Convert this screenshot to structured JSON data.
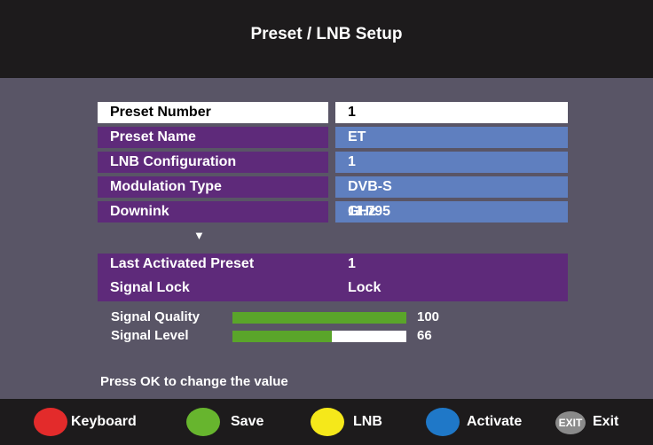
{
  "header": {
    "title": "Preset / LNB Setup"
  },
  "settings": {
    "preset_number": {
      "label": "Preset Number",
      "value": "1"
    },
    "preset_name": {
      "label": "Preset Name",
      "value": "ET"
    },
    "lnb_configuration": {
      "label": "LNB Configuration",
      "value": "1"
    },
    "modulation_type": {
      "label": "Modulation Type",
      "value": "DVB-S"
    },
    "downlink": {
      "label": "Downink",
      "value": "11.795",
      "unit": "GHz"
    }
  },
  "more_indicator": "▼",
  "status": {
    "last_activated": {
      "label": "Last Activated Preset",
      "value": "1"
    },
    "signal_lock": {
      "label": "Signal Lock",
      "value": "Lock"
    }
  },
  "meters": {
    "signal_quality": {
      "label": "Signal Quality",
      "value": "100",
      "fraction": 1.0
    },
    "signal_level": {
      "label": "Signal Level",
      "value": "66",
      "fraction": 0.57
    }
  },
  "hint": "Press OK to change the value",
  "footer": {
    "keyboard": {
      "label": "Keyboard",
      "color": "#e32b2b",
      "icon": "red-button-icon"
    },
    "save": {
      "label": "Save",
      "color": "#67b52e",
      "icon": "green-button-icon"
    },
    "lnb": {
      "label": "LNB",
      "color": "#f5e81a",
      "icon": "yellow-button-icon"
    },
    "activate": {
      "label": "Activate",
      "color": "#1f78c8",
      "icon": "blue-button-icon"
    },
    "exit": {
      "label": "Exit",
      "badge": "EXIT",
      "icon": "exit-button-icon"
    }
  },
  "colors": {
    "background": "#595566",
    "header": "#1d1b1c",
    "label_row": "#5e2a7a",
    "value_row": "#5f7fbf",
    "bar_fill": "#5aa52a"
  }
}
